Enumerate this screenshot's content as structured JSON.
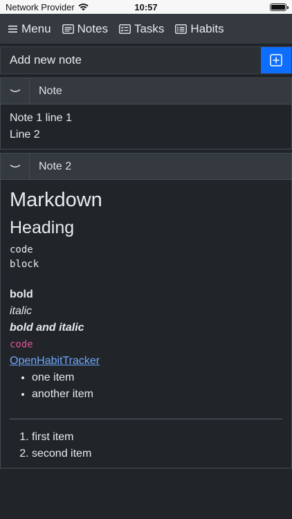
{
  "statusbar": {
    "carrier": "Network Provider",
    "time": "10:57",
    "battery_level": 1.0
  },
  "nav": {
    "items": [
      {
        "label": "Menu",
        "icon": "hamburger-icon"
      },
      {
        "label": "Notes",
        "icon": "notes-icon"
      },
      {
        "label": "Tasks",
        "icon": "tasks-icon"
      },
      {
        "label": "Habits",
        "icon": "habits-icon"
      }
    ]
  },
  "add_note": {
    "placeholder": "Add new note",
    "button_icon": "plus-square-icon",
    "accent": "#0d6efd"
  },
  "notes": [
    {
      "title": "Note",
      "lines": [
        "Note 1 line 1",
        "Line 2"
      ]
    },
    {
      "title": "Note 2",
      "markdown": {
        "h1": "Markdown",
        "h2": "Heading",
        "code_block": [
          "code",
          "block"
        ],
        "bold": "bold",
        "italic": "italic",
        "bold_italic": "bold and italic",
        "inline_code": "code",
        "link": "OpenHabitTracker",
        "bullets": [
          "one item",
          "another item"
        ],
        "ordered": [
          "first item",
          "second item"
        ]
      }
    }
  ],
  "colors": {
    "background": "#212529",
    "navbar": "#343a40",
    "link": "#6ea8fe",
    "inline_code": "#e0539a"
  }
}
